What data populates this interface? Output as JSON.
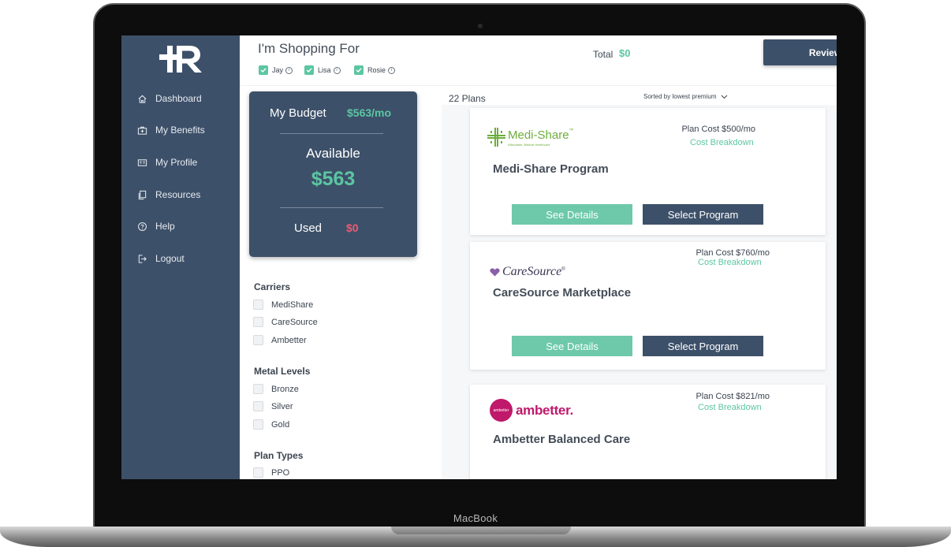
{
  "device": {
    "label": "MacBook"
  },
  "sidebar": {
    "items": [
      {
        "label": "Dashboard",
        "icon": "home-icon"
      },
      {
        "label": "My Benefits",
        "icon": "briefcase-icon"
      },
      {
        "label": "My Profile",
        "icon": "id-card-icon"
      },
      {
        "label": "Resources",
        "icon": "documents-icon"
      },
      {
        "label": "Help",
        "icon": "help-circle-icon"
      },
      {
        "label": "Logout",
        "icon": "logout-icon"
      }
    ]
  },
  "header": {
    "title": "I'm Shopping For",
    "members": [
      {
        "name": "Jay",
        "checked": true
      },
      {
        "name": "Lisa",
        "checked": true
      },
      {
        "name": "Rosie",
        "checked": true
      }
    ],
    "total_label": "Total",
    "total_value": "$0",
    "review_label": "Review"
  },
  "budget": {
    "label": "My Budget",
    "value": "$563/mo",
    "available_label": "Available",
    "available_value": "$563",
    "used_label": "Used",
    "used_value": "$0"
  },
  "filters": {
    "carriers": {
      "title": "Carriers",
      "options": [
        "MediShare",
        "CareSource",
        "Ambetter"
      ]
    },
    "metal_levels": {
      "title": "Metal Levels",
      "options": [
        "Bronze",
        "Silver",
        "Gold"
      ]
    },
    "plan_types": {
      "title": "Plan Types",
      "options": [
        "PPO"
      ]
    }
  },
  "plans": {
    "count_label": "22 Plans",
    "sort_label": "Sorted by lowest premium",
    "items": [
      {
        "name": "Medi-Share Program",
        "cost": "Plan Cost $500/mo",
        "breakdown": "Cost Breakdown",
        "details_label": "See Details",
        "select_label": "Select Program",
        "logo_text": "Medi-Share",
        "logo_tm": "™",
        "logo_tagline": "Affordable, Biblical Healthcare"
      },
      {
        "name": "CareSource Marketplace",
        "cost": "Plan Cost $760/mo",
        "breakdown": "Cost Breakdown",
        "details_label": "See Details",
        "select_label": "Select Program",
        "logo_text": "CareSource",
        "logo_tm": "®"
      },
      {
        "name": "Ambetter Balanced Care",
        "cost": "Plan Cost $821/mo",
        "breakdown": "Cost Breakdown",
        "logo_text": "ambetter.",
        "logo_badge": "ambetter"
      }
    ]
  },
  "colors": {
    "navy": "#3d5069",
    "green": "#5bc6a2",
    "red": "#ef5a73",
    "medishare": "#6cae3b",
    "ambetter": "#c0186a"
  }
}
